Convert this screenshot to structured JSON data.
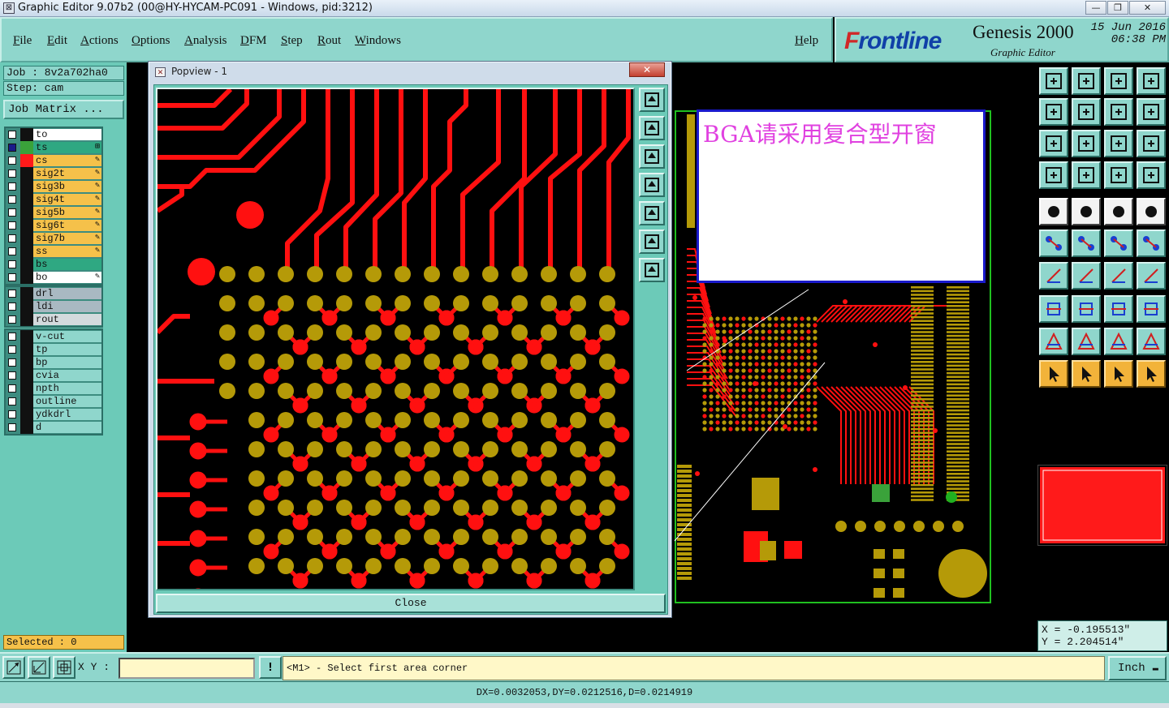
{
  "window": {
    "title": "Graphic Editor 9.07b2 (00@HY-HYCAM-PC091 - Windows, pid:3212)",
    "minimize": "—",
    "maximize": "❐",
    "close": "✕"
  },
  "menu": {
    "items": [
      "File",
      "Edit",
      "Actions",
      "Options",
      "Analysis",
      "DFM",
      "Step",
      "Rout",
      "Windows"
    ],
    "help": "Help"
  },
  "branding": {
    "logo_prefix": "F",
    "logo_rest": "rontline",
    "product": "Genesis 2000",
    "subtitle": "Graphic Editor",
    "date": "15 Jun 2016",
    "time": "06:38 PM"
  },
  "job": {
    "job_label": "Job : 8v2a702ha0",
    "step_label": "Step: cam",
    "matrix_button": "Job Matrix ..."
  },
  "layers": {
    "board": [
      {
        "name": "to",
        "bg": "#ffffff",
        "swatch": "#111111",
        "pen": false,
        "checked": false
      },
      {
        "name": "ts",
        "bg": "#2fa882",
        "swatch": "#3aa23a",
        "pen": false,
        "checked": true,
        "active": true
      },
      {
        "name": "cs",
        "bg": "#f5c14a",
        "swatch": "#ff1a1a",
        "pen": true,
        "checked": false
      },
      {
        "name": "sig2t",
        "bg": "#f5c14a",
        "swatch": "#111111",
        "pen": true,
        "checked": false
      },
      {
        "name": "sig3b",
        "bg": "#f5c14a",
        "swatch": "#111111",
        "pen": true,
        "checked": false
      },
      {
        "name": "sig4t",
        "bg": "#f5c14a",
        "swatch": "#111111",
        "pen": true,
        "checked": false
      },
      {
        "name": "sig5b",
        "bg": "#f5c14a",
        "swatch": "#111111",
        "pen": true,
        "checked": false
      },
      {
        "name": "sig6t",
        "bg": "#f5c14a",
        "swatch": "#111111",
        "pen": true,
        "checked": false
      },
      {
        "name": "sig7b",
        "bg": "#f5c14a",
        "swatch": "#111111",
        "pen": true,
        "checked": false
      },
      {
        "name": "ss",
        "bg": "#f5c14a",
        "swatch": "#111111",
        "pen": true,
        "checked": false
      },
      {
        "name": "bs",
        "bg": "#2fa882",
        "swatch": "#111111",
        "pen": false,
        "checked": false
      },
      {
        "name": "bo",
        "bg": "#ffffff",
        "swatch": "#111111",
        "pen": true,
        "checked": false
      }
    ],
    "drill": [
      {
        "name": "drl",
        "bg": "#a9b9c2",
        "swatch": "#111111",
        "pen": false,
        "checked": false
      },
      {
        "name": "ldi",
        "bg": "#a9b9c2",
        "swatch": "#111111",
        "pen": false,
        "checked": false
      },
      {
        "name": "rout",
        "bg": "#d3dadd",
        "swatch": "#111111",
        "pen": false,
        "checked": false
      }
    ],
    "misc": [
      {
        "name": "v-cut",
        "bg": "#8fd6cc",
        "swatch": "#111111",
        "pen": false,
        "checked": false
      },
      {
        "name": "tp",
        "bg": "#8fd6cc",
        "swatch": "#111111",
        "pen": false,
        "checked": false
      },
      {
        "name": "bp",
        "bg": "#8fd6cc",
        "swatch": "#111111",
        "pen": false,
        "checked": false
      },
      {
        "name": "cvia",
        "bg": "#8fd6cc",
        "swatch": "#111111",
        "pen": false,
        "checked": false
      },
      {
        "name": "npth",
        "bg": "#8fd6cc",
        "swatch": "#111111",
        "pen": false,
        "checked": false
      },
      {
        "name": "outline",
        "bg": "#8fd6cc",
        "swatch": "#111111",
        "pen": false,
        "checked": false
      },
      {
        "name": "ydkdrl",
        "bg": "#8fd6cc",
        "swatch": "#111111",
        "pen": false,
        "checked": false
      },
      {
        "name": "d",
        "bg": "#8fd6cc",
        "swatch": "#111111",
        "pen": false,
        "checked": false
      }
    ]
  },
  "selected": "Selected : 0",
  "popview": {
    "title": "Popview - 1",
    "close_button": "Close",
    "close_x": "✕"
  },
  "note": {
    "text": "BGA请采用复合型开窗"
  },
  "coords": {
    "x": "X = -0.195513\"",
    "y": "Y = 2.204514\""
  },
  "bottom": {
    "xy_label": "X Y :",
    "xy_value": "",
    "bang": "!",
    "prompt": "<M1> - Select first area corner",
    "unit": "Inch",
    "status": "DX=0.0032053,DY=0.0212516,D=0.0214919"
  },
  "colors": {
    "panel": "#8fd6cc",
    "copper": "#ff1010",
    "pad": "#b59a08",
    "board_outline": "#20c020"
  }
}
